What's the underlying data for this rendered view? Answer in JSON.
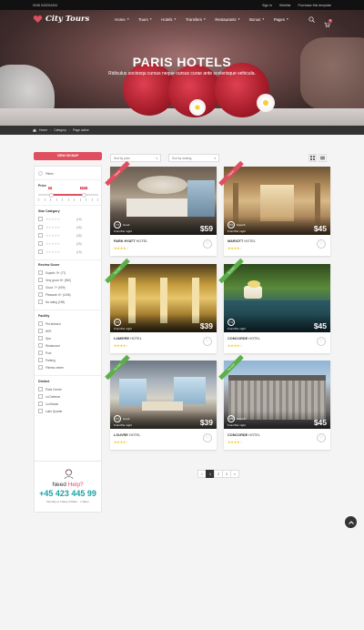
{
  "topbar": {
    "phone": "0045 043204434",
    "sign_in": "Sign in",
    "wishlist": "Wishlist",
    "purchase": "Purchase this template"
  },
  "nav": {
    "logo": "City Tours",
    "menu": [
      "Home",
      "Tours",
      "Hotels",
      "Transfers",
      "Restaurants",
      "Bonus",
      "Pages"
    ],
    "cart_count": "0"
  },
  "hero": {
    "title": "PARIS HOTELS",
    "subtitle": "Ridiculus sociosqu cursus neque cursus curae ante scelerisque vehicula."
  },
  "breadcrumb": [
    "Home",
    "Category",
    "Page active"
  ],
  "sidebar": {
    "map_button": "VIEW ON MAP",
    "filters_label": "Filters",
    "price_label": "Price",
    "price_min_label": "$0",
    "price_max_label": "$120",
    "price_range": {
      "min": 0.22,
      "max": 0.76
    },
    "star_label": "Star Category",
    "stars": [
      {
        "count": "(15)"
      },
      {
        "count": "(45)"
      },
      {
        "count": "(35)"
      },
      {
        "count": "(25)"
      },
      {
        "count": "(15)"
      }
    ],
    "review_label": "Review Score",
    "reviews": [
      "Superb: 9+ (77)",
      "Very good: 8+ (552)",
      "Good: 7+ (909)",
      "Pleasant: 6+ (1196)",
      "No rating (198)"
    ],
    "facility_label": "Facility",
    "facilities": [
      "Pet allowed",
      "WiFi",
      "Spa",
      "Restaurant",
      "Pool",
      "Parking",
      "Fitness center"
    ],
    "district_label": "District",
    "districts": [
      "Paris Centre",
      "La Defance",
      "La Marais",
      "Latin Quarter"
    ],
    "help_title": "Need ",
    "help_title_accent": "Help?",
    "help_phone": "+45 423 445 99",
    "help_hours": "Monday to Friday 9.00am - 7.30pm"
  },
  "toolbar": {
    "sort_price": "Sort by price",
    "sort_ranking": "Sort by ranking"
  },
  "hotels": [
    {
      "ribbon": "Popular",
      "ribbon_color": "red",
      "score": "7.5",
      "score_label": "Good",
      "from": "From/Per night",
      "price": "$59",
      "name": "PARK HYATT",
      "suffix": " HOTEL",
      "stars": "★★★★",
      "empty_stars": "☆"
    },
    {
      "ribbon": "Popular",
      "ribbon_color": "red",
      "score": "8.5",
      "score_label": "Superb",
      "from": "From/Per night",
      "price": "$45",
      "name": "MARIOTT",
      "suffix": " HOTEL",
      "stars": "★★★★",
      "empty_stars": "☆"
    },
    {
      "ribbon": "Top rated",
      "ribbon_color": "green",
      "score": "6.5",
      "score_label": "",
      "from": "From/Per night",
      "price": "$39",
      "name": "LUMIERE",
      "suffix": " HOTEL",
      "stars": "★★★★",
      "empty_stars": "☆"
    },
    {
      "ribbon": "Top rated",
      "ribbon_color": "green",
      "score": "7.5",
      "score_label": "",
      "from": "From/Per night",
      "price": "$45",
      "name": "CONCORDE",
      "suffix": " HOTEL",
      "stars": "★★★★",
      "empty_stars": "☆"
    },
    {
      "ribbon": "Top rated",
      "ribbon_color": "green",
      "score": "6.0",
      "score_label": "Good",
      "from": "From/Per night",
      "price": "$39",
      "name": "LOUVRE",
      "suffix": " HOTEL",
      "stars": "★★★★",
      "empty_stars": "☆"
    },
    {
      "ribbon": "Top rated",
      "ribbon_color": "green",
      "score": "8.5",
      "score_label": "Superb",
      "from": "From/Per night",
      "price": "$45",
      "name": "CONCORDE",
      "suffix": " HOTEL",
      "stars": "★★★★",
      "empty_stars": "☆"
    }
  ],
  "pagination": [
    "«",
    "1",
    "2",
    "3",
    "»"
  ],
  "colors": {
    "accent": "#e04f5f",
    "phone": "#1aa3a3",
    "green_ribbon": "#5bb04a"
  }
}
